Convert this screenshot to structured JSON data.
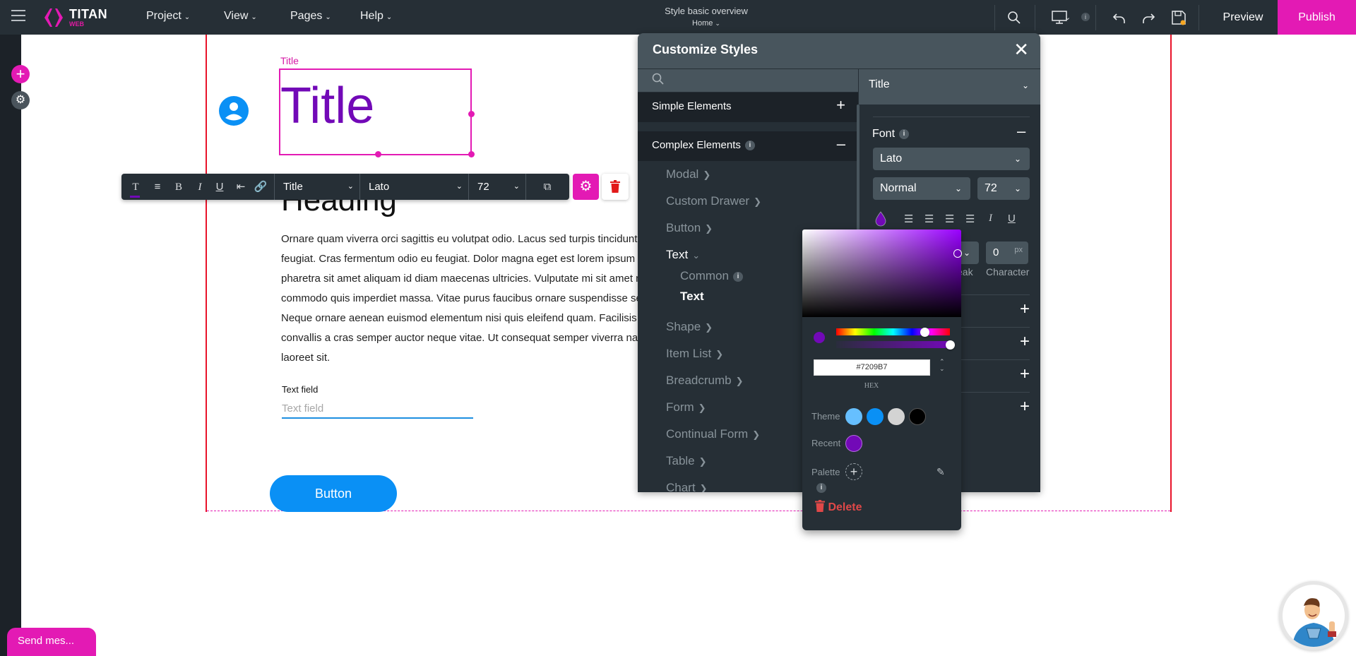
{
  "app": {
    "brand_name": "TITAN",
    "brand_sub": "WEB",
    "menu": [
      {
        "label": "Project"
      },
      {
        "label": "View"
      },
      {
        "label": "Pages"
      },
      {
        "label": "Help"
      }
    ],
    "project_title": "Style basic overview",
    "current_page": "Home",
    "preview_label": "Preview",
    "publish_label": "Publish",
    "unsaved_indicator_color": "#f5a623",
    "accent_color": "#e31ab4"
  },
  "canvas": {
    "title_element_label": "Title",
    "title_text": "Title",
    "title_color": "#7209b7",
    "heading_text": "Heading",
    "paragraph_lines": [
      "Ornare quam viverra orci sagittis eu volutpat odio. Lacus sed turpis tincidunt id aliquet risus",
      "feugiat. Cras fermentum odio eu feugiat. Dolor magna eget est lorem ipsum dolor sit amet",
      "pharetra sit amet aliquam id diam maecenas ultricies. Vulputate mi sit amet mauris",
      "commodo quis imperdiet massa. Vitae purus faucibus ornare suspendisse sed nisi lacus.",
      "Neque ornare aenean euismod elementum nisi quis eleifend quam. Facilisis magna etiam tempor orci",
      "convallis a cras semper auctor neque vitae. Ut consequat semper viverra nam libero justo",
      "laoreet sit."
    ],
    "text_field_label": "Text field",
    "text_field_placeholder": "Text field",
    "text_field_value": "",
    "button_label": "Button"
  },
  "text_toolbar": {
    "style_select": "Title",
    "font_select": "Lato",
    "size_select": "72",
    "active_tool": "text-color"
  },
  "customize_styles": {
    "title": "Customize Styles",
    "search_placeholder": "",
    "sections": [
      {
        "label": "Simple Elements",
        "expanded": false
      },
      {
        "label": "Complex Elements",
        "expanded": true,
        "has_info": true
      }
    ],
    "complex_items": [
      {
        "label": "Modal"
      },
      {
        "label": "Custom Drawer"
      },
      {
        "label": "Button"
      },
      {
        "label": "Text",
        "expanded": true
      },
      {
        "label": "Shape"
      },
      {
        "label": "Item List"
      },
      {
        "label": "Breadcrumb"
      },
      {
        "label": "Form"
      },
      {
        "label": "Continual Form"
      },
      {
        "label": "Table"
      },
      {
        "label": "Chart"
      }
    ],
    "text_subitems": [
      {
        "label": "Common",
        "has_info": true,
        "selected": false
      },
      {
        "label": "Text",
        "selected": true
      }
    ],
    "right_panel": {
      "element_select": "Title",
      "font_section_label": "Font",
      "font_family": "Lato",
      "font_weight": "Normal",
      "font_size": "72",
      "line_break_caption": "eak",
      "character_spacing_value": "0",
      "character_spacing_unit": "px",
      "character_caption": "Character",
      "collapsed_rows": 4
    }
  },
  "color_picker": {
    "hex_value": "#7209B7",
    "format_label": "HEX",
    "hue_position": 0.78,
    "alpha": 1.0,
    "theme_label": "Theme",
    "theme_colors": [
      "#66bfff",
      "#0a90f5",
      "#d3d3d3",
      "#000000"
    ],
    "recent_label": "Recent",
    "recent_colors": [
      "#7209b7"
    ],
    "palette_label": "Palette",
    "delete_label": "Delete"
  },
  "chat_widget": {
    "label": "Send mes..."
  }
}
